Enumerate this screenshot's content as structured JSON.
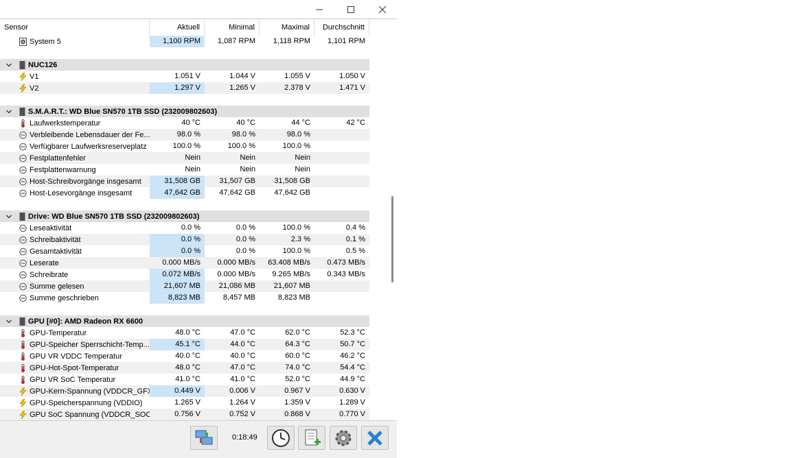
{
  "window": {
    "minimize_icon": "minimize-icon",
    "maximize_icon": "maximize-icon",
    "close_icon": "close-icon"
  },
  "columns": {
    "sensor": "Sensor",
    "current": "Aktuell",
    "min": "Minimal",
    "max": "Maximal",
    "avg": "Durchschnitt"
  },
  "rows": [
    {
      "type": "sensor",
      "icon": "fan-icon",
      "name": "System 5",
      "cur": "1,100 RPM",
      "min": "1,087 RPM",
      "max": "1,118 RPM",
      "avg": "1,101 RPM",
      "hl": true
    },
    {
      "type": "blank"
    },
    {
      "type": "group",
      "name": "NUC126"
    },
    {
      "type": "sensor",
      "icon": "voltage-icon",
      "name": "V1",
      "cur": "1.051 V",
      "min": "1.044 V",
      "max": "1.055 V",
      "avg": "1.050 V",
      "hl": false
    },
    {
      "type": "sensor",
      "icon": "voltage-icon",
      "name": "V2",
      "cur": "1.297 V",
      "min": "1.265 V",
      "max": "2.378 V",
      "avg": "1.471 V",
      "hl": true
    },
    {
      "type": "blank"
    },
    {
      "type": "group",
      "name": "S.M.A.R.T.: WD Blue SN570 1TB SSD (232009802603)"
    },
    {
      "type": "sensor",
      "icon": "thermometer-icon",
      "name": "Laufwerkstemperatur",
      "cur": "40 °C",
      "min": "40 °C",
      "max": "44 °C",
      "avg": "42 °C",
      "hl": false
    },
    {
      "type": "sensor",
      "icon": "gauge-icon",
      "name": "Verbleibende Lebensdauer der Fe...",
      "cur": "98.0 %",
      "min": "98.0 %",
      "max": "98.0 %",
      "avg": "",
      "hl": false
    },
    {
      "type": "sensor",
      "icon": "gauge-icon",
      "name": "Verfügbarer Laufwerksreserveplatz",
      "cur": "100.0 %",
      "min": "100.0 %",
      "max": "100.0 %",
      "avg": "",
      "hl": false
    },
    {
      "type": "sensor",
      "icon": "gauge-icon",
      "name": "Festplattenfehler",
      "cur": "Nein",
      "min": "Nein",
      "max": "Nein",
      "avg": "",
      "hl": false
    },
    {
      "type": "sensor",
      "icon": "gauge-icon",
      "name": "Festplattenwarnung",
      "cur": "Nein",
      "min": "Nein",
      "max": "Nein",
      "avg": "",
      "hl": false
    },
    {
      "type": "sensor",
      "icon": "gauge-icon",
      "name": "Host-Schreibvorgänge insgesamt",
      "cur": "31,508 GB",
      "min": "31,507 GB",
      "max": "31,508 GB",
      "avg": "",
      "hl": true
    },
    {
      "type": "sensor",
      "icon": "gauge-icon",
      "name": "Host-Lesevorgänge insgesamt",
      "cur": "47,642 GB",
      "min": "47,642 GB",
      "max": "47,642 GB",
      "avg": "",
      "hl": true
    },
    {
      "type": "blank"
    },
    {
      "type": "group",
      "name": "Drive: WD Blue SN570 1TB SSD (232009802603)"
    },
    {
      "type": "sensor",
      "icon": "gauge-icon",
      "name": "Leseaktivität",
      "cur": "0.0 %",
      "min": "0.0 %",
      "max": "100.0 %",
      "avg": "0.4 %",
      "hl": false
    },
    {
      "type": "sensor",
      "icon": "gauge-icon",
      "name": "Schreibaktivität",
      "cur": "0.0 %",
      "min": "0.0 %",
      "max": "2.3 %",
      "avg": "0.1 %",
      "hl": true
    },
    {
      "type": "sensor",
      "icon": "gauge-icon",
      "name": "Gesamtaktivität",
      "cur": "0.0 %",
      "min": "0.0 %",
      "max": "100.0 %",
      "avg": "0.5 %",
      "hl": true
    },
    {
      "type": "sensor",
      "icon": "gauge-icon",
      "name": "Leserate",
      "cur": "0.000 MB/s",
      "min": "0.000 MB/s",
      "max": "63.408 MB/s",
      "avg": "0.473 MB/s",
      "hl": false
    },
    {
      "type": "sensor",
      "icon": "gauge-icon",
      "name": "Schreibrate",
      "cur": "0.072 MB/s",
      "min": "0.000 MB/s",
      "max": "9.265 MB/s",
      "avg": "0.343 MB/s",
      "hl": true
    },
    {
      "type": "sensor",
      "icon": "gauge-icon",
      "name": "Summe gelesen",
      "cur": "21,607 MB",
      "min": "21,086 MB",
      "max": "21,607 MB",
      "avg": "",
      "hl": true
    },
    {
      "type": "sensor",
      "icon": "gauge-icon",
      "name": "Summe geschrieben",
      "cur": "8,823 MB",
      "min": "8,457 MB",
      "max": "8,823 MB",
      "avg": "",
      "hl": true
    },
    {
      "type": "blank"
    },
    {
      "type": "group",
      "name": "GPU [#0]: AMD Radeon RX 6600"
    },
    {
      "type": "sensor",
      "icon": "thermometer-icon",
      "name": "GPU-Temperatur",
      "cur": "48.0 °C",
      "min": "47.0 °C",
      "max": "62.0 °C",
      "avg": "52.3 °C",
      "hl": false
    },
    {
      "type": "sensor",
      "icon": "thermometer-icon",
      "name": "GPU-Speicher Sperrschicht-Temp...",
      "cur": "45.1 °C",
      "min": "44.0 °C",
      "max": "64.3 °C",
      "avg": "50.7 °C",
      "hl": true
    },
    {
      "type": "sensor",
      "icon": "thermometer-icon",
      "name": "GPU VR VDDC Temperatur",
      "cur": "40.0 °C",
      "min": "40.0 °C",
      "max": "60.0 °C",
      "avg": "46.2 °C",
      "hl": false
    },
    {
      "type": "sensor",
      "icon": "thermometer-icon",
      "name": "GPU-Hot-Spot-Temperatur",
      "cur": "48.0 °C",
      "min": "47.0 °C",
      "max": "74.0 °C",
      "avg": "54.4 °C",
      "hl": false
    },
    {
      "type": "sensor",
      "icon": "thermometer-icon",
      "name": "GPU VR SoC Temperatur",
      "cur": "41.0 °C",
      "min": "41.0 °C",
      "max": "52.0 °C",
      "avg": "44.9 °C",
      "hl": false
    },
    {
      "type": "sensor",
      "icon": "voltage-icon",
      "name": "GPU-Kern-Spannung (VDDCR_GFX)",
      "cur": "0.449 V",
      "min": "0.006 V",
      "max": "0.967 V",
      "avg": "0.630 V",
      "hl": true
    },
    {
      "type": "sensor",
      "icon": "voltage-icon",
      "name": "GPU-Speicherspannung (VDDIO)",
      "cur": "1.265 V",
      "min": "1.264 V",
      "max": "1.359 V",
      "avg": "1.289 V",
      "hl": false
    },
    {
      "type": "sensor",
      "icon": "voltage-icon",
      "name": "GPU SoC Spannung (VDDCR_SOC)",
      "cur": "0.756 V",
      "min": "0.752 V",
      "max": "0.868 V",
      "avg": "0.770 V",
      "hl": false
    }
  ],
  "toolbar": {
    "timer": "0:18:49",
    "network_icon": "network-icon",
    "clock_icon": "clock-icon",
    "report_icon": "report-add-icon",
    "settings_icon": "gear-icon",
    "close_icon": "close-x-icon"
  }
}
